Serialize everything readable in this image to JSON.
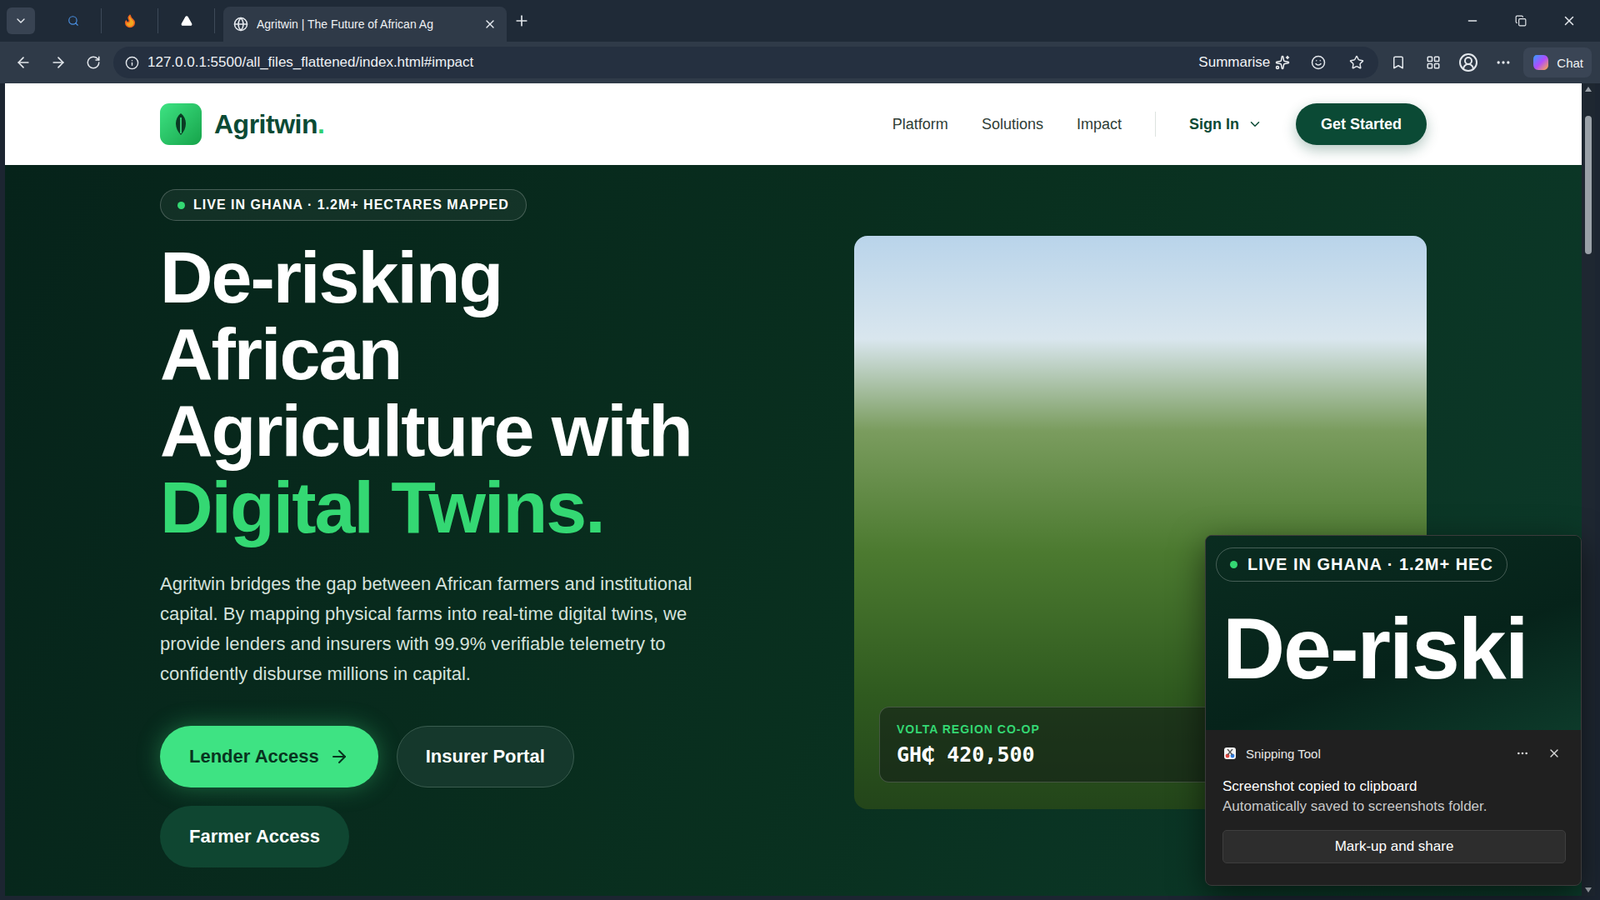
{
  "browser": {
    "tab": {
      "title": "Agritwin | The Future of African Ag",
      "selected": true
    },
    "address": "127.0.0.1:5500/all_files_flattened/index.html#impact",
    "summarise": "Summarise",
    "chat": "Chat"
  },
  "nav": {
    "brand": "Agritwin",
    "brand_dot": ".",
    "links": [
      "Platform",
      "Solutions",
      "Impact"
    ],
    "sign_in": "Sign In",
    "cta": "Get Started"
  },
  "hero": {
    "badge": "LIVE IN GHANA · 1.2M+ HECTARES MAPPED",
    "headline": [
      "De-risking",
      "African",
      "Agriculture with"
    ],
    "headline_accent": "Digital Twins.",
    "body": "Agritwin bridges the gap between African farmers and institutional capital. By mapping physical farms into real-time digital twins, we provide lenders and insurers with 99.9% verifiable telemetry to confidently disburse millions in capital.",
    "buttons": [
      {
        "label": "Lender Access",
        "kind": "primary"
      },
      {
        "label": "Insurer Portal",
        "kind": "outline"
      },
      {
        "label": "Farmer Access",
        "kind": "solid"
      }
    ],
    "stat": {
      "label": "VOLTA REGION CO-OP",
      "value": "GH₵ 420,500"
    }
  },
  "notification": {
    "app": "Snipping Tool",
    "title": "Screenshot copied to clipboard",
    "message": "Automatically saved to screenshots folder.",
    "action": "Mark-up and share",
    "preview": {
      "badge": "LIVE IN GHANA · 1.2M+ HEC",
      "headline": "De-riski"
    }
  },
  "scrollbar": {
    "thumb_start": 0.04,
    "thumb_size": 0.17
  }
}
